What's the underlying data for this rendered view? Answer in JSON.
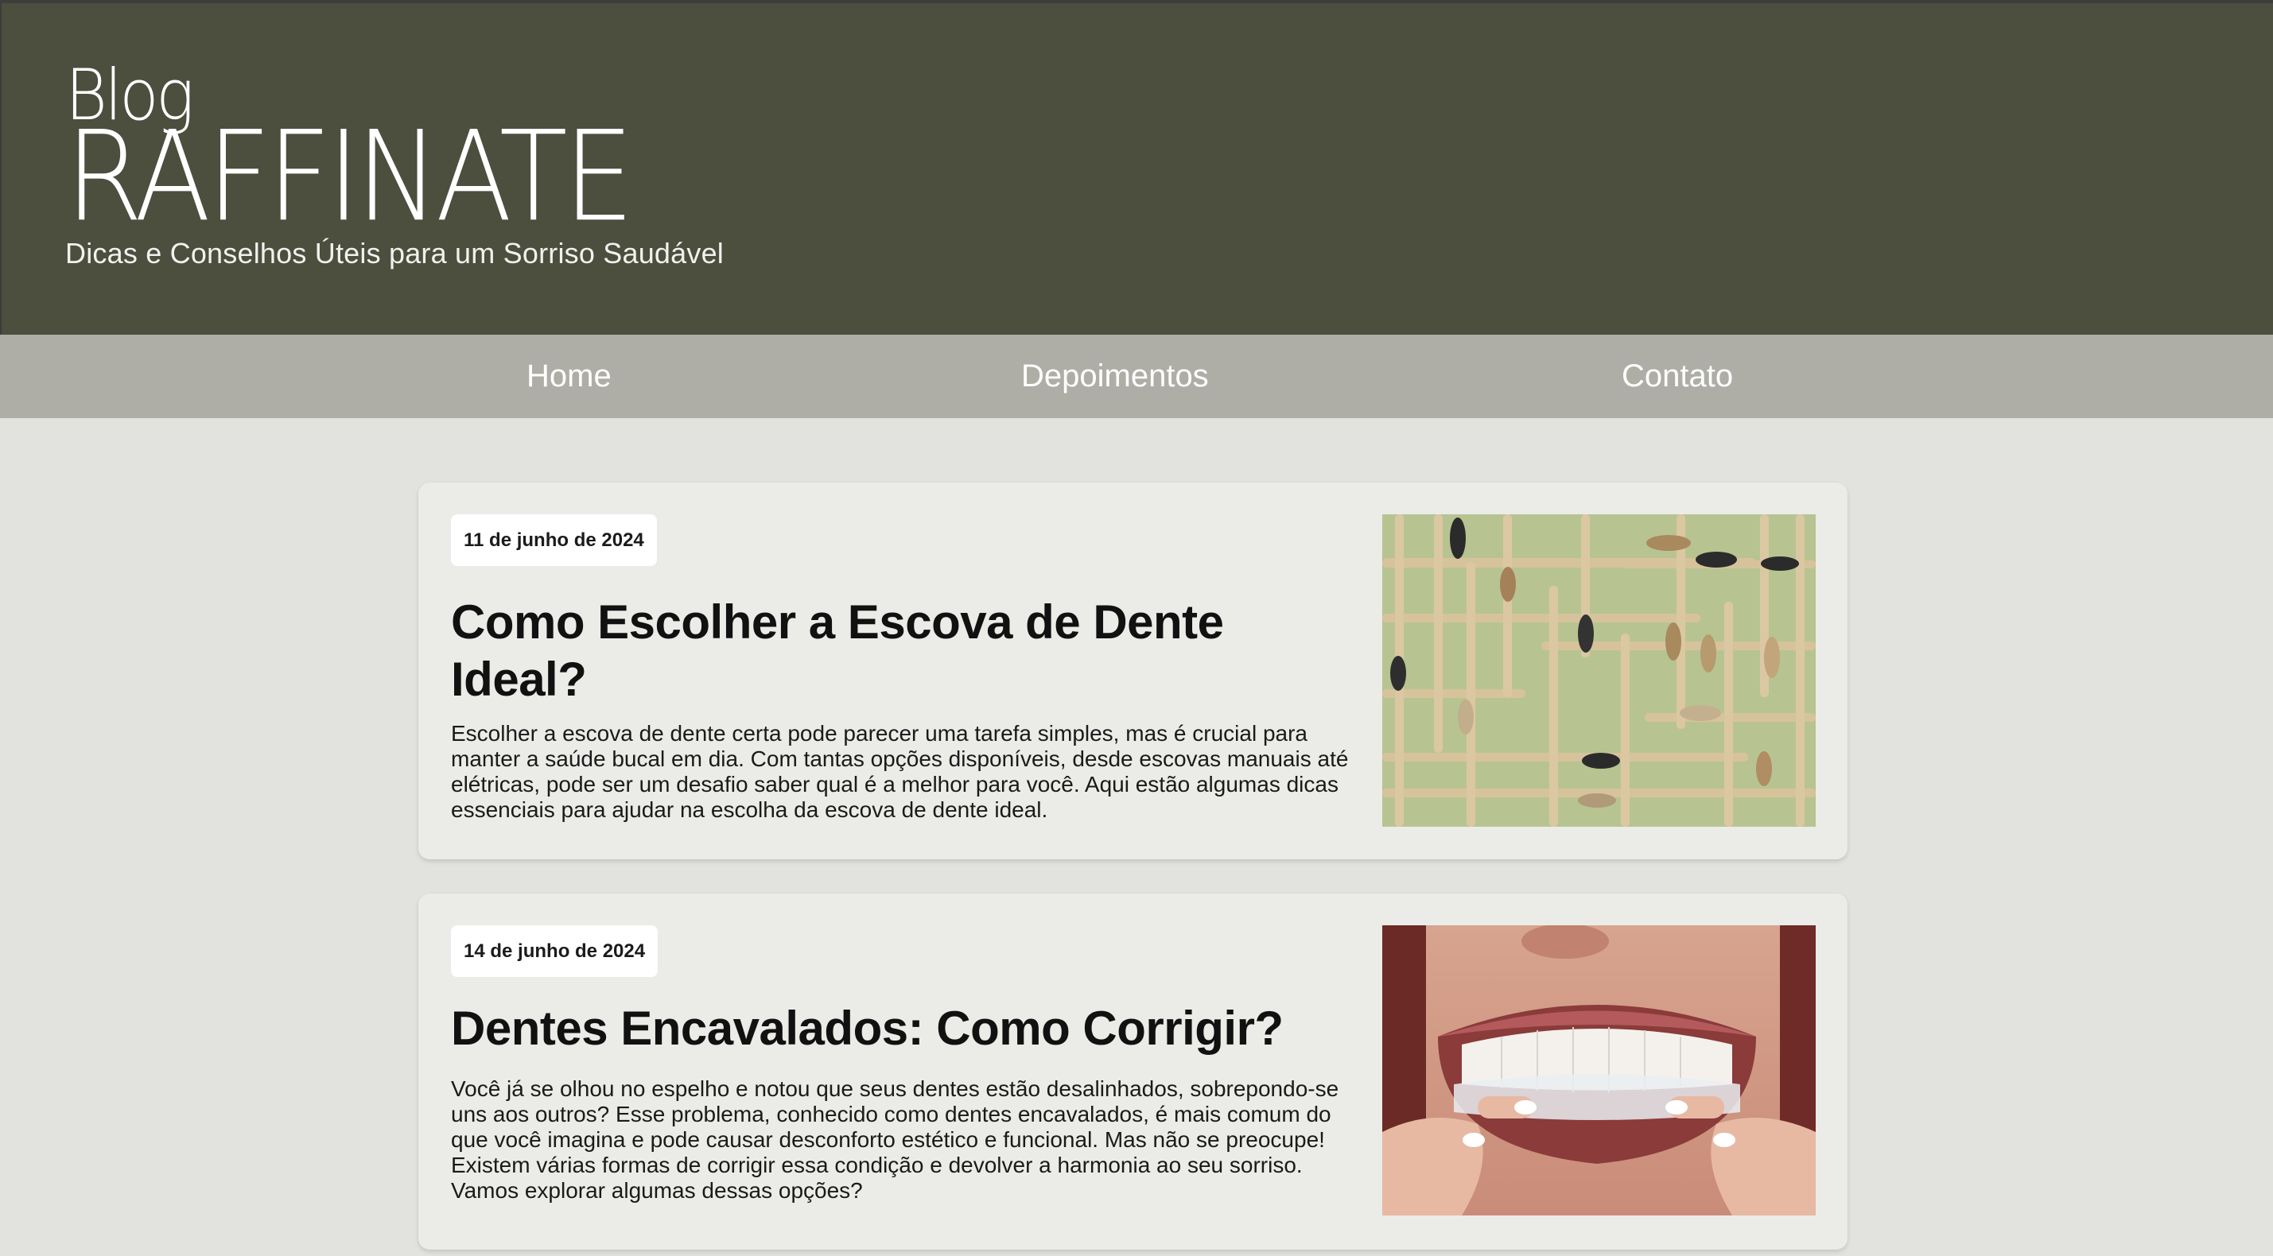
{
  "header": {
    "blog_label": "Blog",
    "brand_name": "RAFFINATE",
    "tagline": "Dicas e Conselhos Úteis para um Sorriso Saudável"
  },
  "nav": {
    "items": [
      {
        "label": "Home"
      },
      {
        "label": "Depoimentos"
      },
      {
        "label": "Contato"
      }
    ]
  },
  "posts": [
    {
      "date": "11 de junho de 2024",
      "title": "Como Escolher a Escova de Dente Ideal?",
      "excerpt": "Escolher a escova de dente certa pode parecer uma tarefa simples, mas é crucial para manter a saúde bucal em dia. Com tantas opções disponíveis, desde escovas manuais até elétricas, pode ser um desafio saber qual é a melhor para você. Aqui estão algumas dicas essenciais para ajudar na escolha da escova de dente ideal."
    },
    {
      "date": "14 de junho de 2024",
      "title": "Dentes Encavalados: Como Corrigir?",
      "excerpt": "Você já se olhou no espelho e notou que seus dentes estão desalinhados, sobrepondo-se uns aos outros? Esse problema, conhecido como dentes encavalados, é mais comum do que você imagina e pode causar desconforto estético e funcional. Mas não se preocupe! Existem várias formas de corrigir essa condição e devolver a harmonia ao seu sorriso. Vamos explorar algumas dessas opções?"
    }
  ],
  "colors": {
    "header_bg": "#4c4e3e",
    "nav_bg": "#aeaea6",
    "page_bg": "#e2e2df",
    "card_bg": "#ebebe8"
  }
}
